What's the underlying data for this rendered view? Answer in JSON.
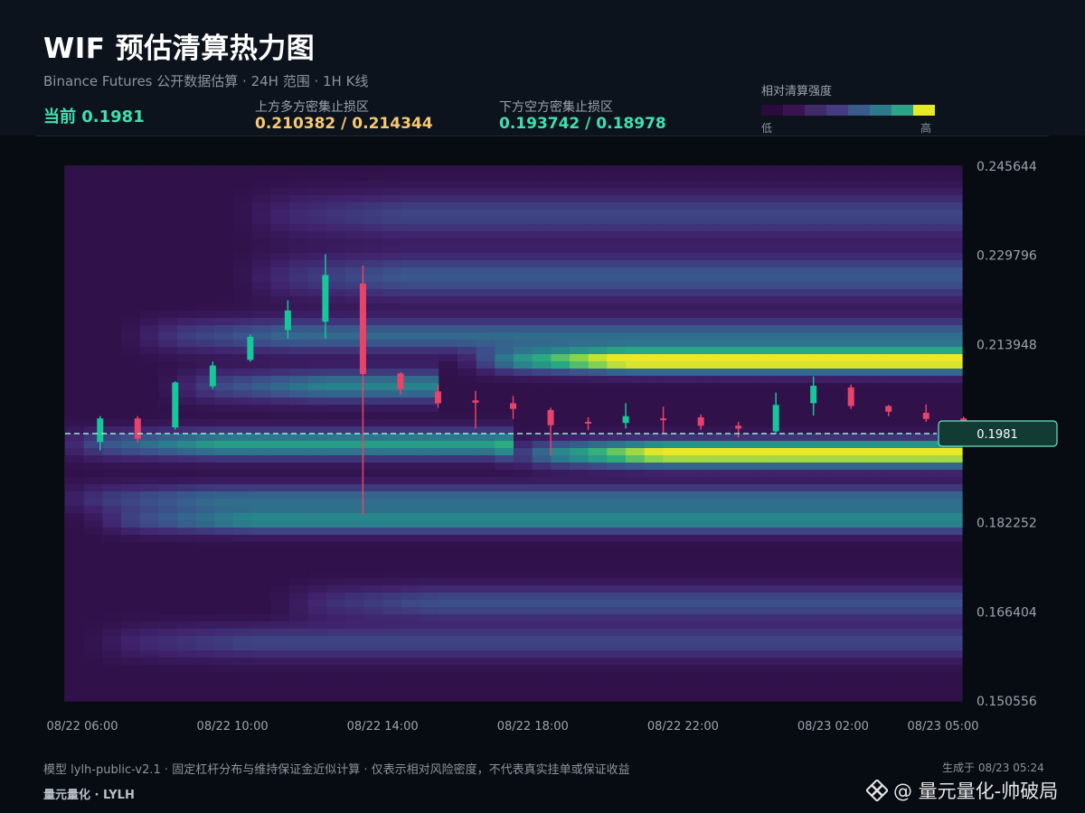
{
  "header": {
    "title": "WIF 预估清算热力图",
    "subtitle": "Binance Futures 公开数据估算 · 24H 范围 · 1H K线",
    "current_label": "当前 0.1981",
    "upper_zone": {
      "label": "上方多方密集止损区",
      "value": "0.210382 / 0.214344",
      "color": "#f7c872"
    },
    "lower_zone": {
      "label": "下方空方密集止损区",
      "value": "0.193742 / 0.18978",
      "color": "#3ee0b0"
    }
  },
  "legend": {
    "title": "相对清算强度",
    "low": "低",
    "high": "高",
    "colors": [
      "#2b0a3d",
      "#3a1450",
      "#402a6a",
      "#453b80",
      "#3b5a8c",
      "#2e7a8a",
      "#2fa28a",
      "#e6e82a"
    ]
  },
  "footer": {
    "model": "模型 lylh-public-v2.1 · 固定杠杆分布与维持保证金近似计算 · 仅表示相对风险密度，不代表真实挂单或保证收益",
    "brand": "量元量化 · LYLH",
    "generated": "生成于 08/23 05:24"
  },
  "watermark": {
    "text": "@ 量元量化-帅破局",
    "icon": "binance-diamond-icon"
  },
  "chart_data": {
    "type": "heatmap",
    "overlay": "candlestick",
    "ylim": [
      0.150556,
      0.245644
    ],
    "y_ticks": [
      "0.245644",
      "0.229796",
      "0.213948",
      "0.198100",
      "0.182252",
      "0.166404",
      "0.150556"
    ],
    "y_tick_values": [
      0.245644,
      0.229796,
      0.213948,
      0.1981,
      0.182252,
      0.166404,
      0.150556
    ],
    "x_labels": [
      "08/22 06:00",
      "08/22 10:00",
      "08/22 14:00",
      "08/22 18:00",
      "08/22 22:00",
      "08/23 02:00",
      "08/23 05:00"
    ],
    "x_label_hours": [
      0,
      4,
      8,
      12,
      16,
      20,
      23
    ],
    "current_price": 0.1981,
    "current_price_label": "0.1981",
    "colors": {
      "up": "#16c79a",
      "down": "#e8436b",
      "price_line": "#8ef0d6"
    },
    "candles": [
      {
        "hour": 0.5,
        "o": 0.1966,
        "h": 0.2012,
        "l": 0.1951,
        "c": 0.2008
      },
      {
        "hour": 1.5,
        "o": 0.2008,
        "h": 0.2012,
        "l": 0.1965,
        "c": 0.1972
      },
      {
        "hour": 2.5,
        "o": 0.1992,
        "h": 0.2074,
        "l": 0.1988,
        "c": 0.2072
      },
      {
        "hour": 3.5,
        "o": 0.2065,
        "h": 0.2109,
        "l": 0.206,
        "c": 0.2102
      },
      {
        "hour": 4.5,
        "o": 0.2112,
        "h": 0.2157,
        "l": 0.2109,
        "c": 0.2153
      },
      {
        "hour": 5.5,
        "o": 0.2165,
        "h": 0.2218,
        "l": 0.215,
        "c": 0.22
      },
      {
        "hour": 6.5,
        "o": 0.218,
        "h": 0.23,
        "l": 0.215,
        "c": 0.2263
      },
      {
        "hour": 7.5,
        "o": 0.2248,
        "h": 0.228,
        "l": 0.1837,
        "c": 0.2087
      },
      {
        "hour": 8.5,
        "o": 0.2088,
        "h": 0.209,
        "l": 0.205,
        "c": 0.206
      },
      {
        "hour": 9.5,
        "o": 0.2056,
        "h": 0.2068,
        "l": 0.2027,
        "c": 0.2035
      },
      {
        "hour": 10.5,
        "o": 0.204,
        "h": 0.2057,
        "l": 0.199,
        "c": 0.2036
      },
      {
        "hour": 11.5,
        "o": 0.2035,
        "h": 0.2048,
        "l": 0.2007,
        "c": 0.2025
      },
      {
        "hour": 12.5,
        "o": 0.2023,
        "h": 0.2027,
        "l": 0.1942,
        "c": 0.1996
      },
      {
        "hour": 13.5,
        "o": 0.2002,
        "h": 0.201,
        "l": 0.1987,
        "c": 0.2
      },
      {
        "hour": 14.5,
        "o": 0.2,
        "h": 0.2035,
        "l": 0.199,
        "c": 0.2012
      },
      {
        "hour": 15.5,
        "o": 0.2008,
        "h": 0.2029,
        "l": 0.1982,
        "c": 0.2006
      },
      {
        "hour": 16.5,
        "o": 0.201,
        "h": 0.2015,
        "l": 0.1988,
        "c": 0.1995
      },
      {
        "hour": 17.5,
        "o": 0.1995,
        "h": 0.2002,
        "l": 0.1974,
        "c": 0.199
      },
      {
        "hour": 18.5,
        "o": 0.1985,
        "h": 0.2054,
        "l": 0.198,
        "c": 0.2032
      },
      {
        "hour": 19.5,
        "o": 0.2035,
        "h": 0.2083,
        "l": 0.2013,
        "c": 0.2066
      },
      {
        "hour": 20.5,
        "o": 0.2063,
        "h": 0.2068,
        "l": 0.2025,
        "c": 0.203
      },
      {
        "hour": 21.5,
        "o": 0.203,
        "h": 0.2032,
        "l": 0.2012,
        "c": 0.202
      },
      {
        "hour": 22.5,
        "o": 0.2018,
        "h": 0.2033,
        "l": 0.2002,
        "c": 0.2007
      },
      {
        "hour": 23.5,
        "o": 0.2008,
        "h": 0.2011,
        "l": 0.1992,
        "c": 0.2
      }
    ],
    "bands": [
      {
        "price": 0.211,
        "start": 12,
        "end": 24,
        "intensity": 1.0,
        "width": 0.0022
      },
      {
        "price": 0.1945,
        "start": 13,
        "end": 24,
        "intensity": 1.0,
        "width": 0.0024
      },
      {
        "price": 0.1962,
        "start": 1,
        "end": 12,
        "intensity": 0.65,
        "width": 0.0025
      },
      {
        "price": 0.1865,
        "start": 1,
        "end": 24,
        "intensity": 0.45,
        "width": 0.0025
      },
      {
        "price": 0.2155,
        "start": 3,
        "end": 24,
        "intensity": 0.45,
        "width": 0.003
      },
      {
        "price": 0.226,
        "start": 6,
        "end": 24,
        "intensity": 0.38,
        "width": 0.004
      },
      {
        "price": 0.2065,
        "start": 4,
        "end": 10,
        "intensity": 0.55,
        "width": 0.0028
      },
      {
        "price": 0.237,
        "start": 6,
        "end": 24,
        "intensity": 0.3,
        "width": 0.004
      },
      {
        "price": 0.1825,
        "start": 2,
        "end": 24,
        "intensity": 0.55,
        "width": 0.0022
      },
      {
        "price": 0.168,
        "start": 7,
        "end": 24,
        "intensity": 0.35,
        "width": 0.003
      },
      {
        "price": 0.161,
        "start": 2,
        "end": 24,
        "intensity": 0.3,
        "width": 0.003
      }
    ]
  }
}
